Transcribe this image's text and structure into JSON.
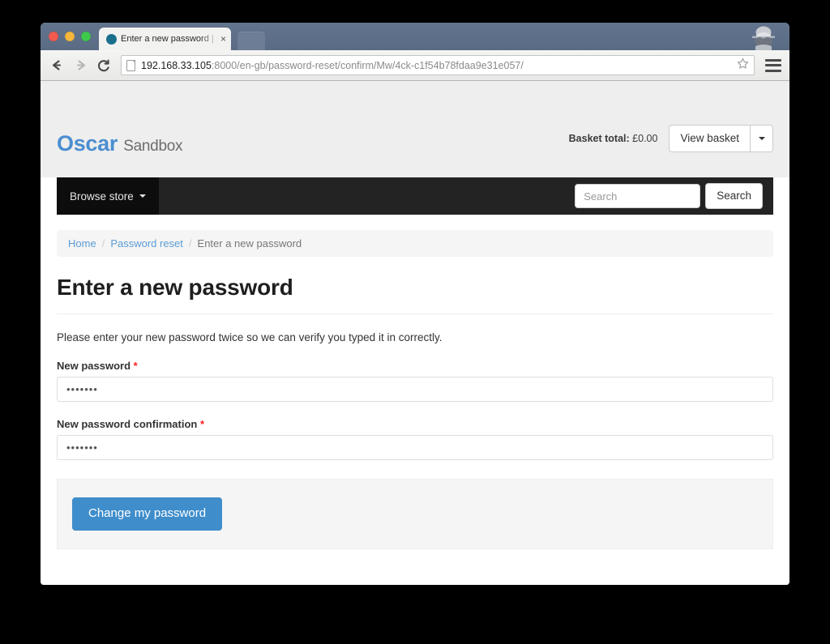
{
  "browser": {
    "tab": {
      "title": "Enter a new password | Os",
      "close_label": "×",
      "favicon_name": "oscar-favicon"
    },
    "new_tab_label": "",
    "toolbar": {
      "back_label": "←",
      "forward_label": "→",
      "reload_label": "C",
      "url_host": "192.168.33.105",
      "url_path": ":8000/en-gb/password-reset/confirm/Mw/4ck-c1f54b78fdaa9e31e057/",
      "url_full": "192.168.33.105:8000/en-gb/password-reset/confirm/Mw/4ck-c1f54b78fdaa9e31e057/",
      "star_title": "Bookmark this page",
      "menu_title": "Customize and control"
    },
    "incognito_title": "You are in incognito mode"
  },
  "header": {
    "brand_name": "Oscar",
    "brand_suffix": "Sandbox",
    "basket_label": "Basket total:",
    "basket_amount": "£0.00",
    "view_basket_label": "View basket",
    "basket_caret": "▾"
  },
  "navbar": {
    "browse_store_label": "Browse store",
    "browse_store_caret": "▾",
    "search_placeholder": "Search",
    "search_value": "",
    "search_button_label": "Search"
  },
  "breadcrumb": [
    {
      "label": "Home",
      "active": false
    },
    {
      "label": "Password reset",
      "active": false
    },
    {
      "label": "Enter a new password",
      "active": true
    }
  ],
  "breadcrumb_separator": "/",
  "main": {
    "title": "Enter a new password",
    "lead": "Please enter your new password twice so we can verify you typed it in correctly.",
    "fields": [
      {
        "label": "New password",
        "required_marker": "*",
        "value": "•••••••",
        "placeholder": ""
      },
      {
        "label": "New password confirmation",
        "required_marker": "*",
        "value": "•••••••",
        "placeholder": ""
      }
    ],
    "submit_label": "Change my password"
  },
  "colors": {
    "brand_blue": "#4a8ed0",
    "primary_button": "#3f8dcb",
    "navbar_bg": "#232323",
    "navbar_item_bg": "#0d0d0d",
    "header_bg": "#eeeeee",
    "link_blue": "#5b9bd5",
    "required_red": "#ff2121",
    "well_bg": "#f5f5f5"
  }
}
